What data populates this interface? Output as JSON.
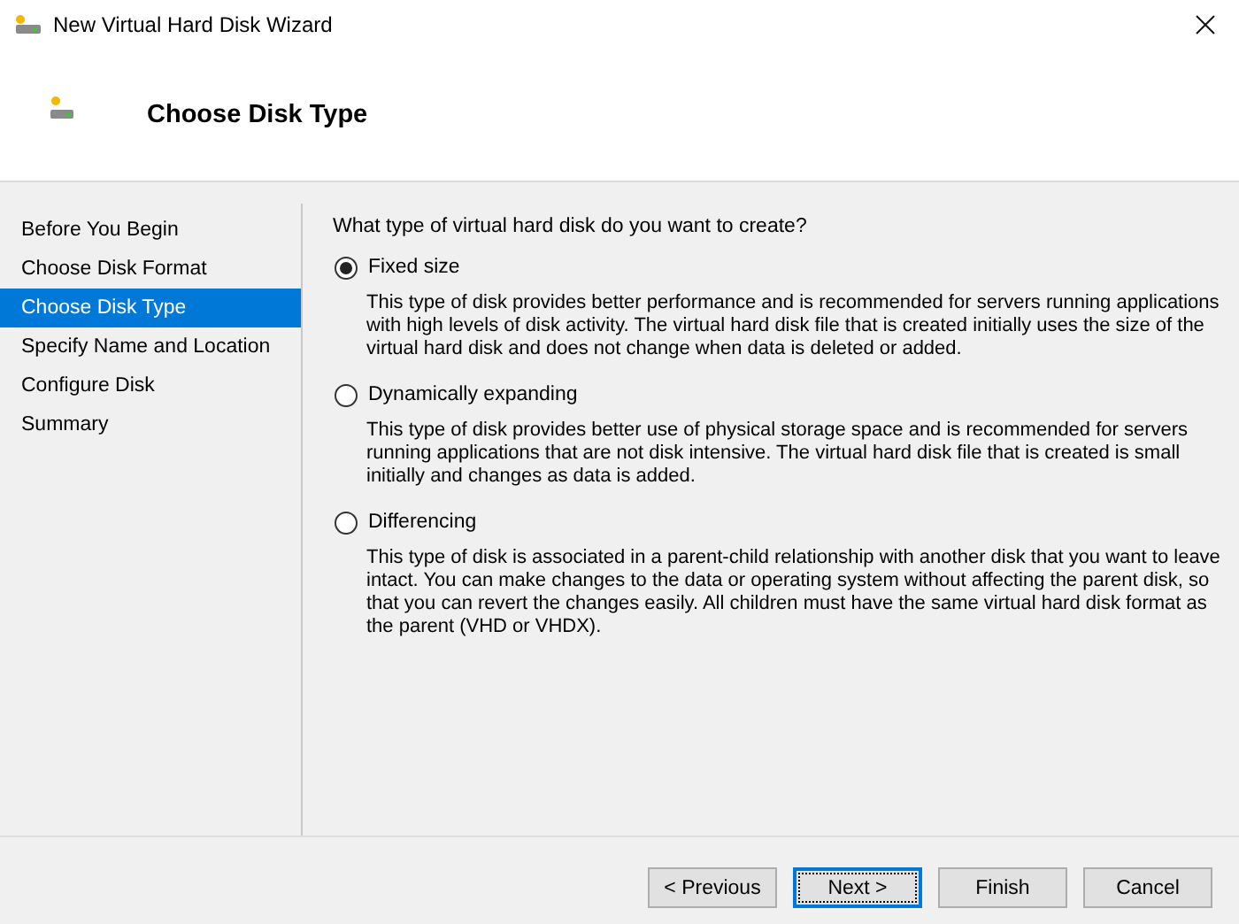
{
  "window": {
    "title": "New Virtual Hard Disk Wizard"
  },
  "header": {
    "title": "Choose Disk Type"
  },
  "sidebar": {
    "items": [
      {
        "label": "Before You Begin",
        "selected": false
      },
      {
        "label": "Choose Disk Format",
        "selected": false
      },
      {
        "label": "Choose Disk Type",
        "selected": true
      },
      {
        "label": "Specify Name and Location",
        "selected": false
      },
      {
        "label": "Configure Disk",
        "selected": false
      },
      {
        "label": "Summary",
        "selected": false
      }
    ]
  },
  "question": "What type of virtual hard disk do you want to create?",
  "options": [
    {
      "label": "Fixed size",
      "selected": true,
      "description": "This type of disk provides better performance and is recommended for servers running applications with high levels of disk activity. The virtual hard disk file that is created initially uses the size of the virtual hard disk and does not change when data is deleted or added."
    },
    {
      "label": "Dynamically expanding",
      "selected": false,
      "description": "This type of disk provides better use of physical storage space and is recommended for servers running applications that are not disk intensive. The virtual hard disk file that is created is small initially and changes as data is added."
    },
    {
      "label": "Differencing",
      "selected": false,
      "description": "This type of disk is associated in a parent-child relationship with another disk that you want to leave intact. You can make changes to the data or operating system without affecting the parent disk, so that you can revert the changes easily. All children must have the same virtual hard disk format as the parent (VHD or VHDX)."
    }
  ],
  "buttons": [
    {
      "label": "< Previous",
      "focused": false
    },
    {
      "label": "Next >",
      "focused": true
    },
    {
      "label": "Finish",
      "focused": false
    },
    {
      "label": "Cancel",
      "focused": false
    }
  ]
}
